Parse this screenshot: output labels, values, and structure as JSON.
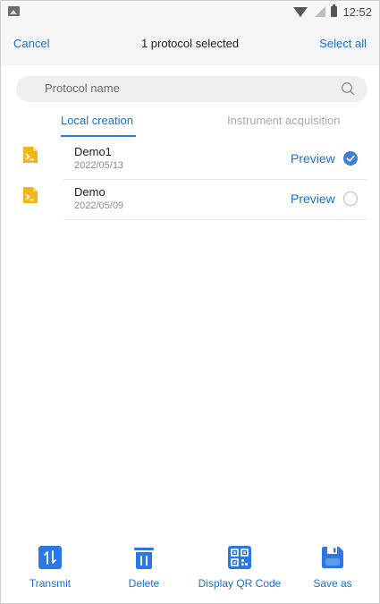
{
  "status_bar": {
    "time": "12:52",
    "icons": [
      "image-icon",
      "wifi-icon",
      "signal-icon",
      "battery-icon"
    ]
  },
  "header": {
    "cancel_label": "Cancel",
    "title": "1 protocol selected",
    "select_all_label": "Select all"
  },
  "search": {
    "placeholder": "Protocol name",
    "icon": "search-icon"
  },
  "tabs": [
    {
      "label": "Local creation",
      "active": true
    },
    {
      "label": "Instrument acquisition",
      "active": false
    }
  ],
  "protocols": [
    {
      "name": "Demo1",
      "date": "2022/05/13",
      "action": "Preview",
      "selected": true
    },
    {
      "name": "Demo",
      "date": "2022/05/09",
      "action": "Preview",
      "selected": false
    }
  ],
  "toolbar": {
    "transmit_label": "Transmit",
    "delete_label": "Delete",
    "qr_label": "Display QR Code",
    "save_label": "Save as"
  },
  "colors": {
    "accent": "#1f6fcc",
    "icon_blue": "#2b78e4",
    "file_icon": "#f2b51b",
    "header_bg": "#f6f6f6"
  }
}
